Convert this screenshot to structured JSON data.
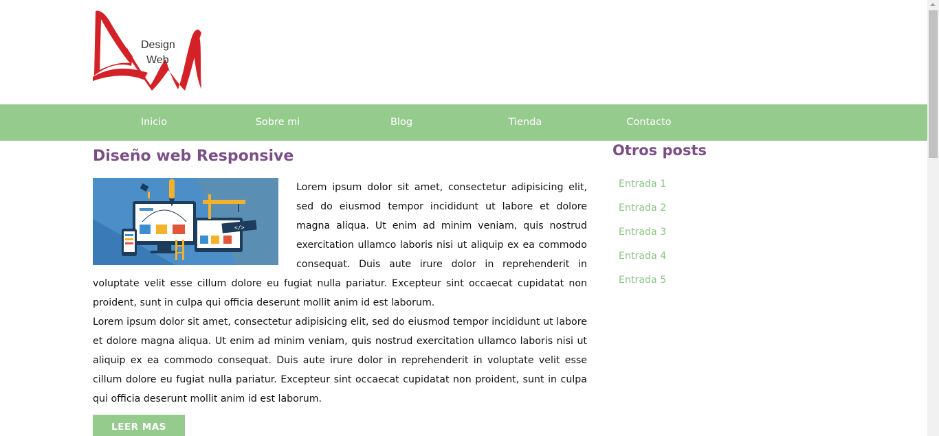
{
  "logo": {
    "line1": "Design",
    "line2": "Web"
  },
  "nav": {
    "items": [
      {
        "label": "Inicio"
      },
      {
        "label": "Sobre mi"
      },
      {
        "label": "Blog"
      },
      {
        "label": "Tienda"
      },
      {
        "label": "Contacto"
      }
    ]
  },
  "post": {
    "title": "Diseño web Responsive",
    "paragraph1": "Lorem ipsum dolor sit amet, consectetur adipisicing elit, sed do eiusmod tempor incididunt ut labore et dolore magna aliqua. Ut enim ad minim veniam, quis nostrud exercitation ullamco laboris nisi ut aliquip ex ea commodo consequat. Duis aute irure dolor in reprehenderit in voluptate velit esse cillum dolore eu fugiat nulla pariatur. Excepteur sint occaecat cupidatat non proident, sunt in culpa qui officia deserunt mollit anim id est laborum.",
    "paragraph2": "Lorem ipsum dolor sit amet, consectetur adipisicing elit, sed do eiusmod tempor incididunt ut labore et dolore magna aliqua. Ut enim ad minim veniam, quis nostrud exercitation ullamco laboris nisi ut aliquip ex ea commodo consequat. Duis aute irure dolor in reprehenderit in voluptate velit esse cillum dolore eu fugiat nulla pariatur. Excepteur sint occaecat cupidatat non proident, sunt in culpa qui officia deserunt mollit anim id est laborum.",
    "image_code_tag": "</>",
    "read_more": "LEER MAS"
  },
  "sidebar": {
    "title": "Otros posts",
    "items": [
      {
        "label": "Entrada 1"
      },
      {
        "label": "Entrada 2"
      },
      {
        "label": "Entrada 3"
      },
      {
        "label": "Entrada 4"
      },
      {
        "label": "Entrada 5"
      }
    ]
  },
  "colors": {
    "nav_bg": "#96cb8e",
    "title": "#7b4f86",
    "sidebar_link": "#8cc585",
    "logo_red": "#d42027"
  }
}
